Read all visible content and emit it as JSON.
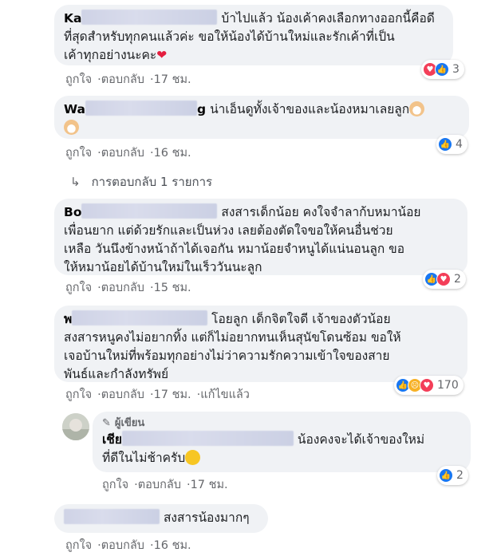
{
  "comments": [
    {
      "name_prefix": "Ka",
      "text_lines": [
        "บ้าไปแล้ว น้องเค้าคงเลือกทางออกนี้คือดี",
        "ที่สุดสำหรับทุกคนแล้วค่ะ ขอให้น้องได้บ้านใหม่และรักเค้าที่เป็น",
        "เค้าทุกอย่างนะคะ"
      ],
      "like_label": "ถูกใจ",
      "reply_label": "ตอบกลับ",
      "time": "17 ชม.",
      "reaction_count": "3",
      "reaction_icons": [
        "love-icon",
        "like-icon"
      ]
    },
    {
      "name_prefix": "Wa",
      "name_suffix": "g",
      "text_lines": [
        "น่าเอ็นดูทั้งเจ้าของและน้องหมาเลยลูก"
      ],
      "like_label": "ถูกใจ",
      "reply_label": "ตอบกลับ",
      "time": "16 ชม.",
      "reaction_count": "4",
      "reaction_icons": [
        "like-icon"
      ]
    },
    {
      "name_prefix": "Bo",
      "text_lines": [
        "สงสารเด็กน้อย คงใจจำลาก้บหมาน้อย",
        "เพื่อนยาก แต่ด้วยรักและเป็นห่วง เลยต้องตัดใจขอให้คนอื่นช่วย",
        "เหลือ วันนึงข้างหน้าถ้าได้เจอกัน หมาน้อยจำหนูได้แน่นอนลูก ขอ",
        "ให้หมาน้อยได้บ้านใหม่ในเร็ววันนะลูก"
      ],
      "like_label": "ถูกใจ",
      "reply_label": "ตอบกลับ",
      "time": "15 ชม.",
      "reaction_count": "2",
      "reaction_icons": [
        "like-icon",
        "love-icon"
      ]
    },
    {
      "name_prefix": "พ",
      "text_lines": [
        "โอยลูก เด็กจิตใจดี เจ้าของตัวน้อย",
        "สงสารหนูคงไม่อยากทิ้ง แต่ก็ไม่อยากทนเห็นสุนัขโดนซ้อม ขอให้",
        "เจอบ้านใหม่ที่พร้อมทุกอย่างไม่ว่าความรักความเข้าใจของสาย",
        "พันธ์และกำลังทรัพย์"
      ],
      "like_label": "ถูกใจ",
      "reply_label": "ตอบกลับ",
      "time": "17 ชม.",
      "edited_label": "แก้ไขแล้ว",
      "reaction_count": "170",
      "reaction_icons": [
        "like-icon",
        "sad-icon",
        "love-icon"
      ]
    },
    {
      "author_badge": "ผู้เขียน",
      "name_prefix": "เชีย",
      "text_lines": [
        "น้องคงจะได้เจ้าของใหม่",
        "ที่ดีในไม่ช้าครับ"
      ],
      "like_label": "ถูกใจ",
      "reply_label": "ตอบกลับ",
      "time": "17 ชม.",
      "reaction_count": "2",
      "reaction_icons": [
        "like-icon"
      ]
    },
    {
      "name_prefix": "",
      "text_lines": [
        "สงสารน้องมากๆ"
      ],
      "like_label": "ถูกใจ",
      "reply_label": "ตอบกลับ",
      "time": "16 ชม."
    }
  ],
  "replies_link": "การตอบกลับ 1 รายการ",
  "colors": {
    "bubble": "#f0f2f5",
    "like": "#1877f2",
    "love": "#f33e58",
    "meta": "#65676b"
  }
}
